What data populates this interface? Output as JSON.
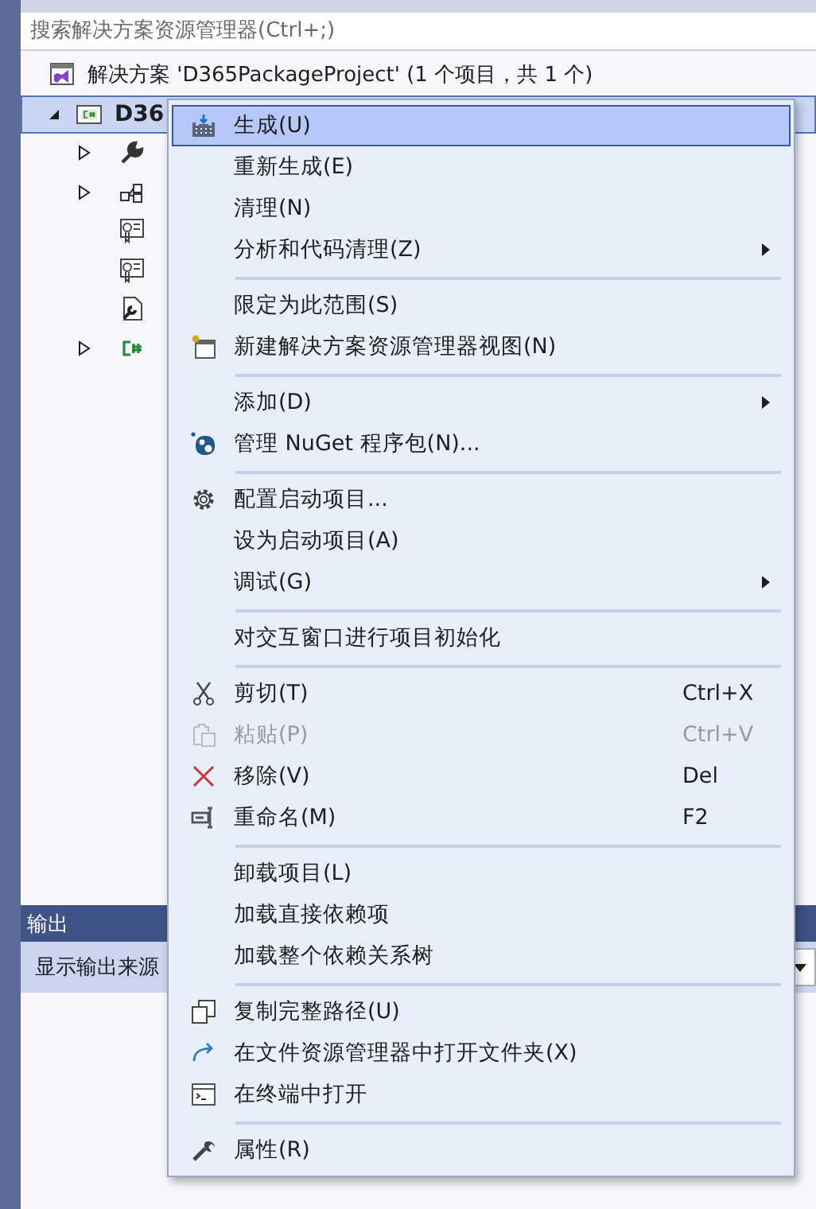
{
  "search": {
    "placeholder": "搜索解决方案资源管理器(Ctrl+;)"
  },
  "solution": {
    "label": "解决方案 'D365PackageProject' (1 个项目，共 1 个)"
  },
  "project": {
    "label": "D36",
    "selected": true,
    "expanded": true
  },
  "tree_children": [
    {
      "expandable": true
    },
    {
      "expandable": true
    },
    {
      "expandable": false
    },
    {
      "expandable": false
    },
    {
      "expandable": false
    },
    {
      "expandable": true
    }
  ],
  "output_panel": {
    "title": "输出",
    "source_label": "显示输出来源"
  },
  "context_menu": [
    {
      "kind": "item",
      "label": "生成(U)",
      "selected": true
    },
    {
      "kind": "item",
      "label": "重新生成(E)",
      "selected": false
    },
    {
      "kind": "item",
      "label": "清理(N)",
      "selected": false
    },
    {
      "kind": "item",
      "label": "分析和代码清理(Z)",
      "submenu": true,
      "selected": false
    },
    {
      "kind": "separator"
    },
    {
      "kind": "item",
      "label": "限定为此范围(S)",
      "selected": false
    },
    {
      "kind": "item",
      "label": "新建解决方案资源管理器视图(N)",
      "selected": false
    },
    {
      "kind": "separator"
    },
    {
      "kind": "item",
      "label": "添加(D)",
      "submenu": true,
      "selected": false
    },
    {
      "kind": "item",
      "label": "管理 NuGet 程序包(N)...",
      "selected": false
    },
    {
      "kind": "separator"
    },
    {
      "kind": "item",
      "label": "配置启动项目...",
      "selected": false
    },
    {
      "kind": "item",
      "label": "设为启动项目(A)",
      "selected": false
    },
    {
      "kind": "item",
      "label": "调试(G)",
      "submenu": true,
      "selected": false
    },
    {
      "kind": "separator"
    },
    {
      "kind": "item",
      "label": "对交互窗口进行项目初始化",
      "selected": false
    },
    {
      "kind": "separator"
    },
    {
      "kind": "item",
      "label": "剪切(T)",
      "shortcut": "Ctrl+X",
      "selected": false
    },
    {
      "kind": "item",
      "label": "粘贴(P)",
      "shortcut": "Ctrl+V",
      "disabled": true,
      "selected": false
    },
    {
      "kind": "item",
      "label": "移除(V)",
      "shortcut": "Del",
      "selected": false
    },
    {
      "kind": "item",
      "label": "重命名(M)",
      "shortcut": "F2",
      "selected": false
    },
    {
      "kind": "separator"
    },
    {
      "kind": "item",
      "label": "卸载项目(L)",
      "selected": false
    },
    {
      "kind": "item",
      "label": "加载直接依赖项",
      "selected": false
    },
    {
      "kind": "item",
      "label": "加载整个依赖关系树",
      "selected": false
    },
    {
      "kind": "separator"
    },
    {
      "kind": "item",
      "label": "复制完整路径(U)",
      "selected": false
    },
    {
      "kind": "item",
      "label": "在文件资源管理器中打开文件夹(X)",
      "selected": false
    },
    {
      "kind": "item",
      "label": "在终端中打开",
      "selected": false
    },
    {
      "kind": "separator"
    },
    {
      "kind": "item",
      "label": "属性(R)",
      "selected": false
    }
  ]
}
